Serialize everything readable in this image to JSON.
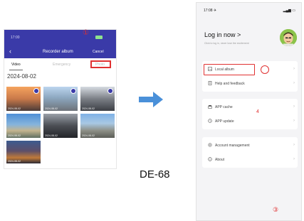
{
  "left_phone": {
    "status_bar": {
      "time": "17:00",
      "battery": "▮"
    },
    "title": "Recorder album",
    "cancel": "Cancel",
    "back_icon": "back-chevron-icon",
    "tabs": [
      "Video",
      "Emergency",
      "Photo"
    ],
    "date": "2024-08-02",
    "thumbnails": [
      {
        "label": "2024-08-02",
        "scene": "sunset-road",
        "selected": true
      },
      {
        "label": "2024-08-02",
        "scene": "highway",
        "selected": true
      },
      {
        "label": "2024-08-02",
        "scene": "city-street",
        "selected": true
      },
      {
        "label": "2024-08-02",
        "scene": "coast-road",
        "selected": false
      },
      {
        "label": "2024-08-02",
        "scene": "dark-street",
        "selected": false
      },
      {
        "label": "2024-08-02",
        "scene": "mountain-road",
        "selected": false
      },
      {
        "label": "2024-08-02",
        "scene": "night-city",
        "selected": false
      }
    ],
    "marker": "①"
  },
  "model": "DE-68",
  "right_phone": {
    "status_bar": {
      "time": "17:08 ✈",
      "signal": "▂▄▆ ▭"
    },
    "login_title": "Log in now >",
    "login_subtitle": "Click to log in, never lose the excitement",
    "menu": [
      {
        "label": "Local album",
        "icon": "image-icon"
      },
      {
        "label": "Help and feedback",
        "icon": "help-doc-icon"
      },
      {
        "label": "APP cache",
        "icon": "broom-icon"
      },
      {
        "label": "APP update",
        "icon": "update-icon"
      },
      {
        "label": "Account management",
        "icon": "account-gear-icon"
      },
      {
        "label": "About",
        "icon": "info-icon"
      }
    ],
    "marker_4": "4",
    "marker_3": "③"
  },
  "colors": {
    "accent": "#3a3aa8",
    "highlight": "#e03131",
    "arrow": "#4a90d9"
  }
}
